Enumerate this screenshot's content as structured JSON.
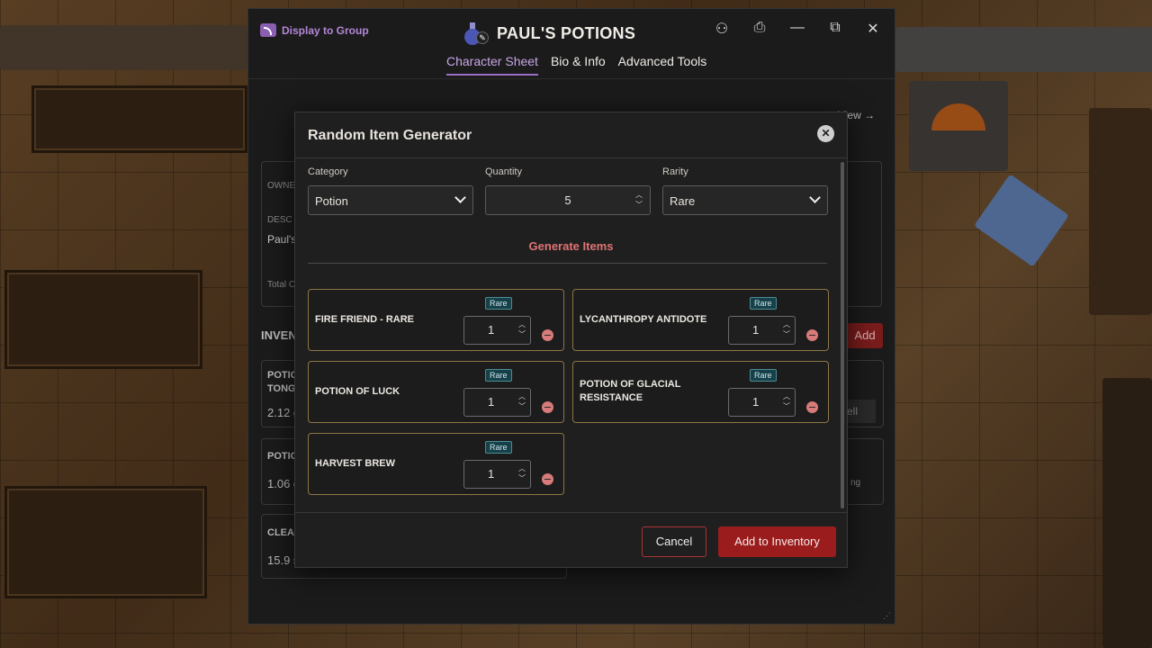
{
  "window": {
    "display_to_group": "Display to Group",
    "title": "PAUL'S POTIONS",
    "tabs": [
      {
        "label": "Character Sheet",
        "active": true
      },
      {
        "label": "Bio & Info",
        "active": false
      },
      {
        "label": "Advanced Tools",
        "active": false
      }
    ],
    "icons": [
      "user-settings-icon",
      "print-icon",
      "minimize-icon",
      "popout-icon",
      "close-icon"
    ]
  },
  "background_sheet": {
    "view_link": "View →",
    "partial_labels": {
      "owner": "OWNE",
      "description": "DESC",
      "desc_value": "Paul's",
      "total": "Total C",
      "inventory": "INVEN",
      "item1_line1": "POTIO",
      "item1_line2": "TONG",
      "item1_weight": "2.12 g",
      "item2": "POTIO",
      "item2_weight": "1.06 g",
      "item3": "CLEAN",
      "item3_weight": "15.9 s",
      "add": "Add",
      "sell": "ell",
      "ng": "ng"
    }
  },
  "modal": {
    "title": "Random Item Generator",
    "category": {
      "label": "Category",
      "value": "Potion"
    },
    "quantity": {
      "label": "Quantity",
      "value": "5"
    },
    "rarity": {
      "label": "Rarity",
      "value": "Rare"
    },
    "generate_label": "Generate Items",
    "items": [
      {
        "name": "FIRE FRIEND - RARE",
        "rarity": "Rare",
        "qty": "1"
      },
      {
        "name": "LYCANTHROPY ANTIDOTE",
        "rarity": "Rare",
        "qty": "1"
      },
      {
        "name": "POTION OF LUCK",
        "rarity": "Rare",
        "qty": "1"
      },
      {
        "name": "POTION OF GLACIAL RESISTANCE",
        "rarity": "Rare",
        "qty": "1"
      },
      {
        "name": "HARVEST BREW",
        "rarity": "Rare",
        "qty": "1"
      }
    ],
    "cancel_label": "Cancel",
    "add_label": "Add to Inventory"
  },
  "colors": {
    "accent_purple": "#9a6cc4",
    "danger_red": "#9b1c1c",
    "card_border_gold": "#8d7744",
    "rarity_badge": "#16404a"
  }
}
